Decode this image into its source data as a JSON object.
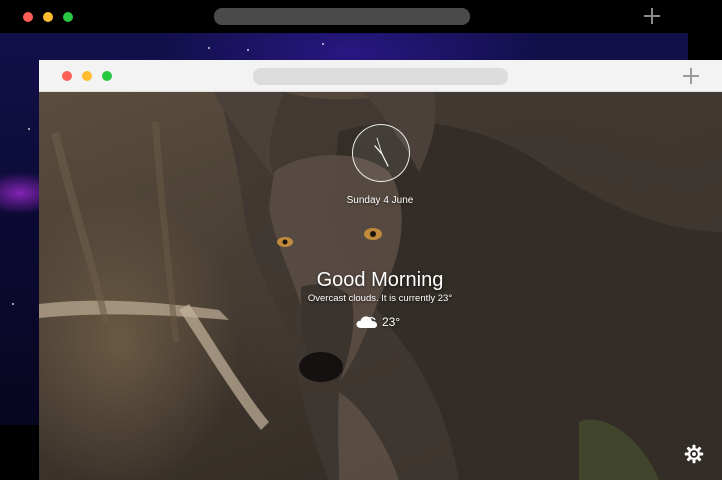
{
  "back_window": {
    "traffic_lights": [
      "#ff5f57",
      "#febc2e",
      "#28c840"
    ]
  },
  "front_window": {
    "traffic_lights": [
      "#ff5f57",
      "#febc2e",
      "#28c840"
    ]
  },
  "newtab": {
    "date": "Sunday 4 June",
    "greeting": "Good Morning",
    "weather_description": "Overcast clouds. It is currently 23°",
    "temperature": "23°",
    "weather_icon": "cloud-icon",
    "settings_icon": "gear-icon"
  }
}
